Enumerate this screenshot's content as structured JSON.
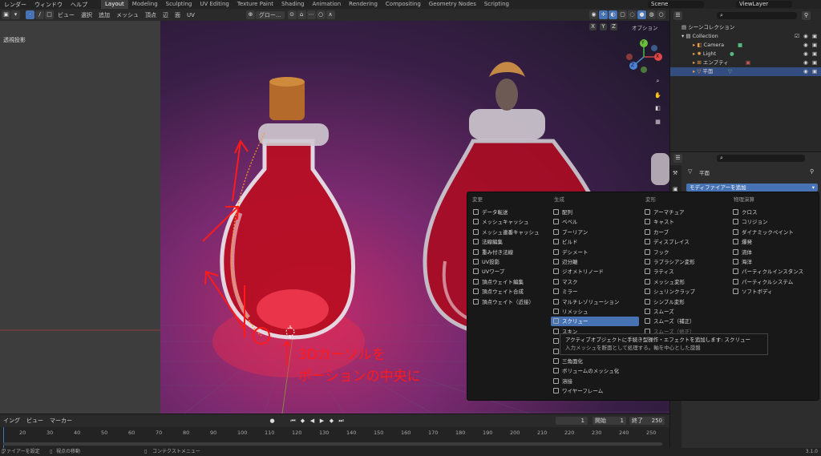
{
  "menu": {
    "items": [
      "レンダー",
      "ウィンドウ",
      "ヘルプ"
    ],
    "workspaces": [
      "Layout",
      "Modeling",
      "Sculpting",
      "UV Editing",
      "Texture Paint",
      "Shading",
      "Animation",
      "Rendering",
      "Compositing",
      "Geometry Nodes",
      "Scripting"
    ],
    "scene": "Scene",
    "view_layer": "ViewLayer"
  },
  "viewport_header": {
    "menu": [
      "ビュー",
      "選択",
      "追加",
      "メッシュ",
      "頂点",
      "辺",
      "面",
      "UV"
    ],
    "orientation": "グロー...",
    "options": "オプション"
  },
  "viewport": {
    "view_label": "透視投影",
    "gizmo": {
      "x": "X",
      "y": "Y",
      "z": "Z"
    },
    "note_line1": "3Dカーソルを",
    "note_line2": "ポーションの中央に"
  },
  "outliner": {
    "scene_collection": "シーンコレクション",
    "rows": [
      "Collection",
      "Camera",
      "Light",
      "エンプティ",
      "平面"
    ]
  },
  "properties": {
    "object_name": "平面",
    "add_modifier": "モディファイアーを追加"
  },
  "popup": {
    "columns": [
      {
        "title": "変更",
        "items": [
          "データ転送",
          "メッシュキャッシュ",
          "メッシュ連番キャッシュ",
          "法線編集",
          "重み付き法線",
          "UV投影",
          "UVワープ",
          "頂点ウェイト編集",
          "頂点ウェイト合成",
          "頂点ウェイト（近接）"
        ]
      },
      {
        "title": "生成",
        "items": [
          "配列",
          "ベベル",
          "ブーリアン",
          "ビルド",
          "デシメート",
          "辺分離",
          "ジオメトリノード",
          "マスク",
          "ミラー",
          "マルチレゾリューション",
          "リメッシュ",
          "スクリュー",
          "スキン",
          "ソリッ",
          "サブデ",
          "三角面化",
          "ボリュームのメッシュ化",
          "溶接",
          "ワイヤーフレーム"
        ]
      },
      {
        "title": "変形",
        "items": [
          "アーマチュア",
          "キャスト",
          "カーブ",
          "ディスプレイス",
          "フック",
          "ラプラシアン変形",
          "ラティス",
          "メッシュ変形",
          "シュリンクラップ",
          "シンプル変形",
          "スムーズ",
          "スムーズ（補正）",
          "スムーズ（修正）",
          "",
          "波"
        ]
      },
      {
        "title": "物理演算",
        "items": [
          "クロス",
          "コリジョン",
          "ダイナミックペイント",
          "爆発",
          "流体",
          "海洋",
          "パーティクルインスタンス",
          "パーティクルシステム",
          "ソフトボディ"
        ]
      }
    ],
    "highlighted": "スクリュー",
    "tooltip_line1": "アクティブオブジェクトに手続き型操作・エフェクトを追加します: スクリュー",
    "tooltip_line2": "入力メッシュを断面として処理する。軸を中心とした旋盤"
  },
  "timeline": {
    "menu": [
      "イング",
      "ビュー",
      "マーカー"
    ],
    "current_frame": "1",
    "start_label": "開始",
    "start": "1",
    "end_label": "終了",
    "end": "250",
    "ticks": [
      "20",
      "30",
      "40",
      "50",
      "60",
      "70",
      "80",
      "90",
      "100",
      "110",
      "120",
      "130",
      "140",
      "150",
      "160",
      "170",
      "180",
      "190",
      "200",
      "210",
      "220",
      "230",
      "240",
      "250"
    ]
  },
  "statusbar": {
    "items": [
      "ファイアーを設定",
      "視点の移動",
      "コンテクストメニュー"
    ],
    "version": "3.1.0"
  },
  "colors": {
    "accent": "#4772b3",
    "annotation_red": "#ff1a1a",
    "potion_red": "#e0102a"
  }
}
